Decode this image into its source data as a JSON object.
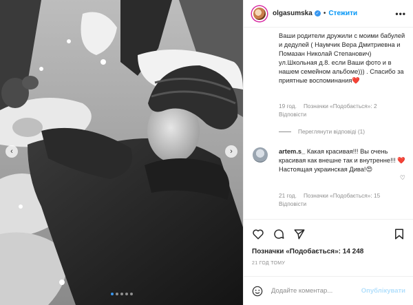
{
  "post": {
    "username": "olgasumska",
    "separator": "•",
    "follow_label": "Стежити",
    "more_label": "•••"
  },
  "comments": {
    "first": {
      "text": "Ваши родители дружили с моими бабулей и дедулей ( Наумчик Вера Дмитриевна и Помазан Николай Степанович) ул.Школьная д.8. если Ваши фото и в нашем семейном альбоме))) . Спасибо за приятные воспоминания",
      "emoji": "❤️",
      "age": "19 год.",
      "likes": "Позначки «Подобається»: 2",
      "reply": "Відповісти"
    },
    "view_replies": "Переглянути відповіді (1)",
    "second": {
      "user": "artem.s_",
      "text": " Какая красивая!!! Вы очень красивая как внешне так и внутренне!!! ",
      "emoji1": "❤️",
      "text2": " Настоящая украинская Дива!",
      "emoji2": "😍",
      "age": "21 год.",
      "likes": "Позначки «Подобається»: 15",
      "reply": "Відповісти"
    }
  },
  "stats": {
    "likes": "Позначки «Подобається»: 14 248",
    "time": "21 ГОД ТОМУ"
  },
  "composer": {
    "placeholder": "Додайте коментар...",
    "publish_label": "Опублікувати"
  },
  "carousel": {
    "prev_icon": "chevron-left-icon",
    "next_icon": "chevron-right-icon",
    "count": 5,
    "active_index": 0
  },
  "colors": {
    "accent": "#0095f6",
    "heart": "#ed4956",
    "muted": "#8e8e8e"
  }
}
